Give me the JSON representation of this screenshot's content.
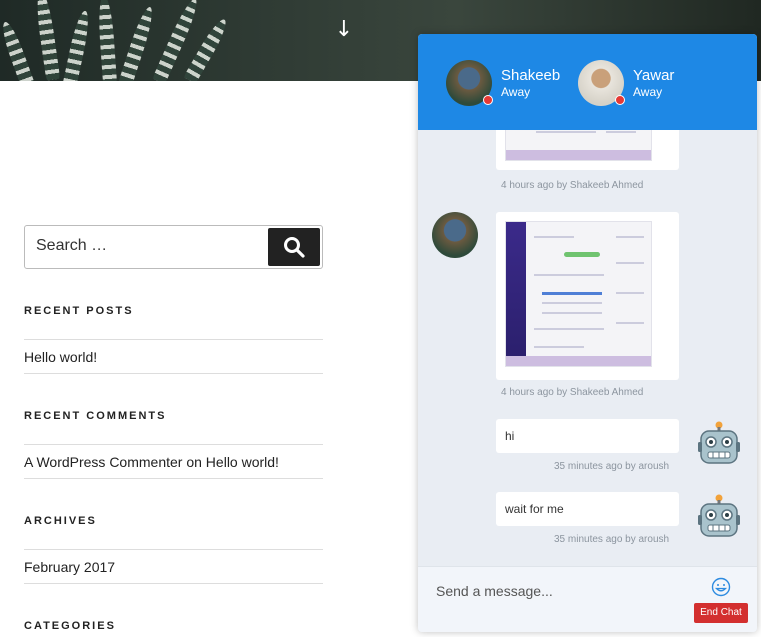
{
  "sidebar": {
    "search_placeholder": "Search …",
    "widgets": [
      {
        "title": "RECENT POSTS",
        "items": [
          "Hello world!"
        ]
      },
      {
        "title": "RECENT COMMENTS",
        "items": [
          "A WordPress Commenter on Hello world!"
        ]
      },
      {
        "title": "ARCHIVES",
        "items": [
          "February 2017"
        ]
      },
      {
        "title": "CATEGORIES",
        "items": []
      }
    ]
  },
  "chat": {
    "agents": [
      {
        "name": "Shakeeb",
        "status": "Away"
      },
      {
        "name": "Yawar",
        "status": "Away"
      }
    ],
    "messages": [
      {
        "meta": "4 hours ago by Shakeeb Ahmed"
      },
      {
        "meta": "4 hours ago by Shakeeb Ahmed"
      },
      {
        "text": "hi",
        "meta": "35 minutes ago by aroush"
      },
      {
        "text": "wait for me",
        "meta": "35 minutes ago by aroush"
      }
    ],
    "compose_placeholder": "Send a message...",
    "end_chat_label": "End Chat"
  },
  "icons": {
    "hero_arrow": "down-arrow-icon",
    "search": "search-icon",
    "emoji": "smiley-icon",
    "bot_avatar": "robot-icon"
  },
  "colors": {
    "chat_header": "#1e88e5",
    "status_away": "#e53935",
    "end_chat": "#d32f2f"
  }
}
